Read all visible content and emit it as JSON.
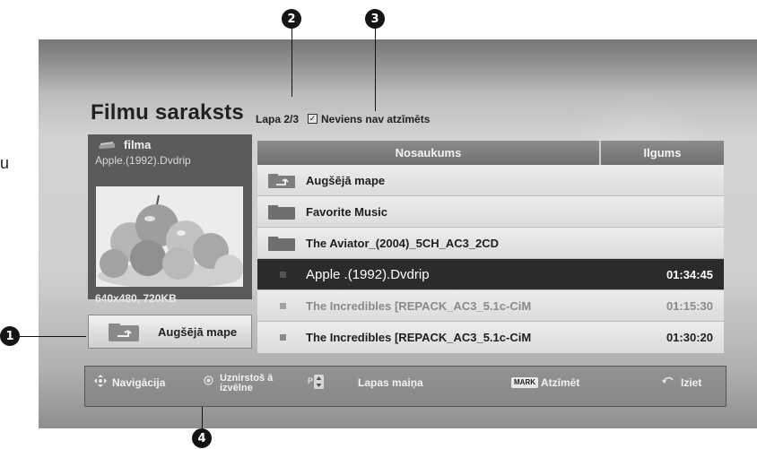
{
  "page": {
    "stray_char": "u"
  },
  "callouts": [
    "1",
    "2",
    "3",
    "4"
  ],
  "screen": {
    "title": "Filmu saraksts",
    "page_info": "Lapa 2/3",
    "mark_status": "Neviens nav atzīmēts"
  },
  "preview": {
    "type_label": "filma",
    "file_name": "Apple.(1992).Dvdrip",
    "resolution": "640x480, 720KB",
    "icon": "film-icon"
  },
  "up_button": {
    "label": "Augšējā mape",
    "icon": "folder-up-icon"
  },
  "list": {
    "columns": {
      "name": "Nosaukums",
      "duration": "Ilgums"
    },
    "rows": [
      {
        "name": "Augšējā mape",
        "duration": "",
        "icon": "folder-up-icon"
      },
      {
        "name": "Favorite Music",
        "duration": "",
        "icon": "folder-icon"
      },
      {
        "name": "The Aviator_(2004)_5CH_AC3_2CD",
        "duration": "",
        "icon": "folder-icon"
      },
      {
        "name": "Apple .(1992).Dvdrip",
        "duration": "01:34:45",
        "icon": "file-icon",
        "selected": true
      },
      {
        "name": "The Incredibles [REPACK_AC3_5.1c-CiM",
        "duration": "01:15:30",
        "icon": "file-icon"
      },
      {
        "name": "The Incredibles [REPACK_AC3_5.1c-CiM",
        "duration": "01:30:20",
        "icon": "file-icon"
      }
    ]
  },
  "navbar": {
    "navigation": "Navigācija",
    "popup_menu_line1": "Uznirstoš ā",
    "popup_menu_line2": "izvēlne",
    "page_change": "Lapas maiņa",
    "mark_key": "MARK",
    "mark": "Atzīmēt",
    "exit": "Iziet",
    "page_key": "P"
  },
  "colors": {
    "selected_row": "#2b2b2b",
    "header": "#7c7c7c",
    "marker": "#141414"
  }
}
